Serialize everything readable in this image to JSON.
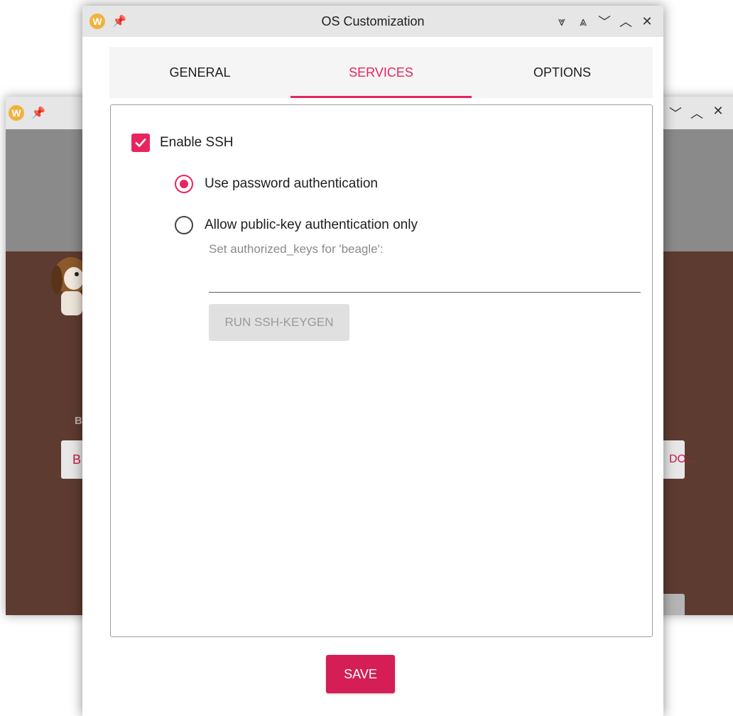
{
  "background_window": {
    "partial_label": "B",
    "left_button_text": "B",
    "right_button_text": "DO.."
  },
  "dialog": {
    "title": "OS Customization",
    "controls": [
      "⩔",
      "⩓",
      "﹀",
      "︿",
      "✕"
    ]
  },
  "tabs": [
    {
      "label": "GENERAL",
      "active": false
    },
    {
      "label": "SERVICES",
      "active": true
    },
    {
      "label": "OPTIONS",
      "active": false
    }
  ],
  "services": {
    "enable_ssh_label": "Enable SSH",
    "enable_ssh_checked": true,
    "password_auth_label": "Use password authentication",
    "password_auth_selected": true,
    "pubkey_auth_label": "Allow public-key authentication only",
    "pubkey_auth_selected": false,
    "authorized_keys_label": "Set authorized_keys for 'beagle':",
    "authorized_keys_value": "",
    "keygen_button": "RUN SSH-KEYGEN"
  },
  "save_button": "SAVE",
  "colors": {
    "accent": "#e8245f",
    "save": "#d51e55",
    "background_app": "#5e3b30"
  }
}
